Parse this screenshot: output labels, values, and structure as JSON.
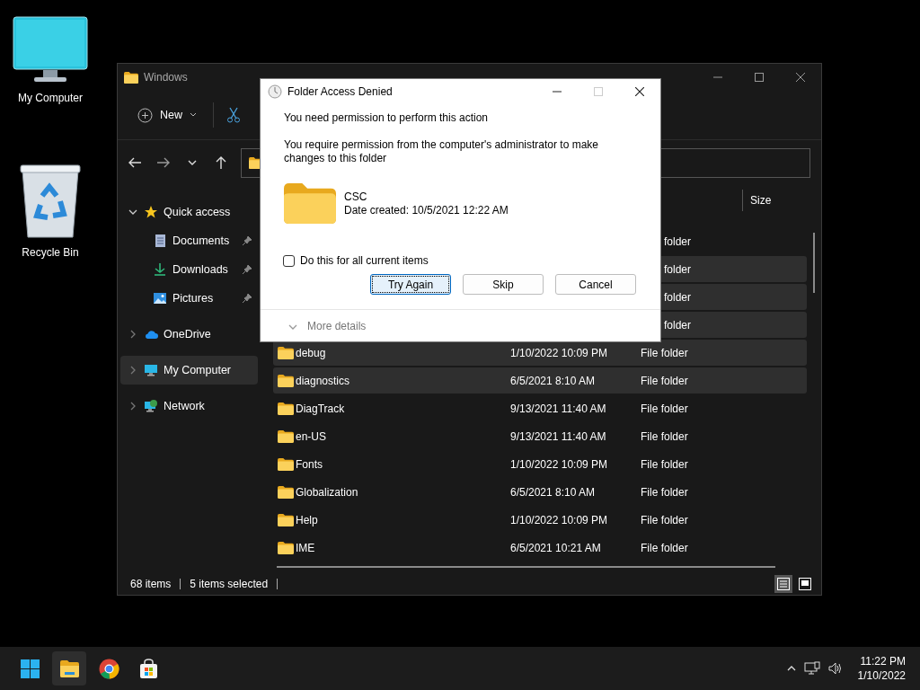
{
  "desktop_icons": [
    {
      "kind": "computer",
      "label": "My Computer"
    },
    {
      "kind": "recycle",
      "label": "Recycle Bin"
    }
  ],
  "explorer": {
    "title": "Windows",
    "new_label": "New",
    "columns": [
      {
        "label": "Size"
      }
    ],
    "sidebar": [
      {
        "label": "Quick access",
        "kind": "star",
        "expanded": true,
        "selected": false,
        "children": [
          {
            "label": "Documents",
            "kind": "document",
            "pinned": true
          },
          {
            "label": "Downloads",
            "kind": "download",
            "pinned": true
          },
          {
            "label": "Pictures",
            "kind": "picture",
            "pinned": true
          }
        ]
      },
      {
        "label": "OneDrive",
        "kind": "cloud",
        "expanded": false,
        "selected": false
      },
      {
        "label": "My Computer",
        "kind": "computer",
        "expanded": false,
        "selected": true
      },
      {
        "label": "Network",
        "kind": "network",
        "expanded": false,
        "selected": false
      }
    ],
    "rows": [
      {
        "kind": "covered",
        "type": "folder",
        "selected": false
      },
      {
        "kind": "covered",
        "type": "folder",
        "selected": true
      },
      {
        "kind": "covered",
        "type": "folder",
        "selected": true
      },
      {
        "kind": "covered",
        "type": "folder",
        "selected": true
      },
      {
        "kind": "full",
        "name": "debug",
        "date": "1/10/2022 10:09 PM",
        "type": "File folder",
        "selected": true
      },
      {
        "kind": "full",
        "name": "diagnostics",
        "date": "6/5/2021 8:10 AM",
        "type": "File folder",
        "selected": true
      },
      {
        "kind": "full",
        "name": "DiagTrack",
        "date": "9/13/2021 11:40 AM",
        "type": "File folder",
        "selected": false
      },
      {
        "kind": "full",
        "name": "en-US",
        "date": "9/13/2021 11:40 AM",
        "type": "File folder",
        "selected": false
      },
      {
        "kind": "full",
        "name": "Fonts",
        "date": "1/10/2022 10:09 PM",
        "type": "File folder",
        "selected": false
      },
      {
        "kind": "full",
        "name": "Globalization",
        "date": "6/5/2021 8:10 AM",
        "type": "File folder",
        "selected": false
      },
      {
        "kind": "full",
        "name": "Help",
        "date": "1/10/2022 10:09 PM",
        "type": "File folder",
        "selected": false
      },
      {
        "kind": "full",
        "name": "IME",
        "date": "6/5/2021 10:21 AM",
        "type": "File folder",
        "selected": false
      }
    ],
    "status": {
      "count": "68 items",
      "selection": "5 items selected"
    },
    "view_modes": [
      {
        "kind": "details",
        "selected": true
      },
      {
        "kind": "tiles",
        "selected": false
      }
    ]
  },
  "dialog": {
    "title": "Folder Access Denied",
    "caption_buttons": [
      {
        "kind": "minimize",
        "disabled": false
      },
      {
        "kind": "maximize",
        "disabled": true
      },
      {
        "kind": "close",
        "disabled": false
      }
    ],
    "heading": "You need permission to perform this action",
    "message": "You require permission from the computer's administrator to make changes to this folder",
    "item_name": "CSC",
    "item_date": "Date created: 10/5/2021 12:22 AM",
    "checkbox": {
      "label": "Do this for all current items",
      "checked": false
    },
    "buttons": [
      {
        "label": "Try Again",
        "default": true
      },
      {
        "label": "Skip",
        "default": false
      },
      {
        "label": "Cancel",
        "default": false
      }
    ],
    "more_details": "More details"
  },
  "taskbar": {
    "apps": [
      {
        "kind": "start",
        "active": false
      },
      {
        "kind": "explorer",
        "active": true
      },
      {
        "kind": "browser",
        "active": false
      },
      {
        "kind": "store",
        "active": false
      }
    ],
    "time": "11:22 PM",
    "date": "1/10/2022"
  }
}
